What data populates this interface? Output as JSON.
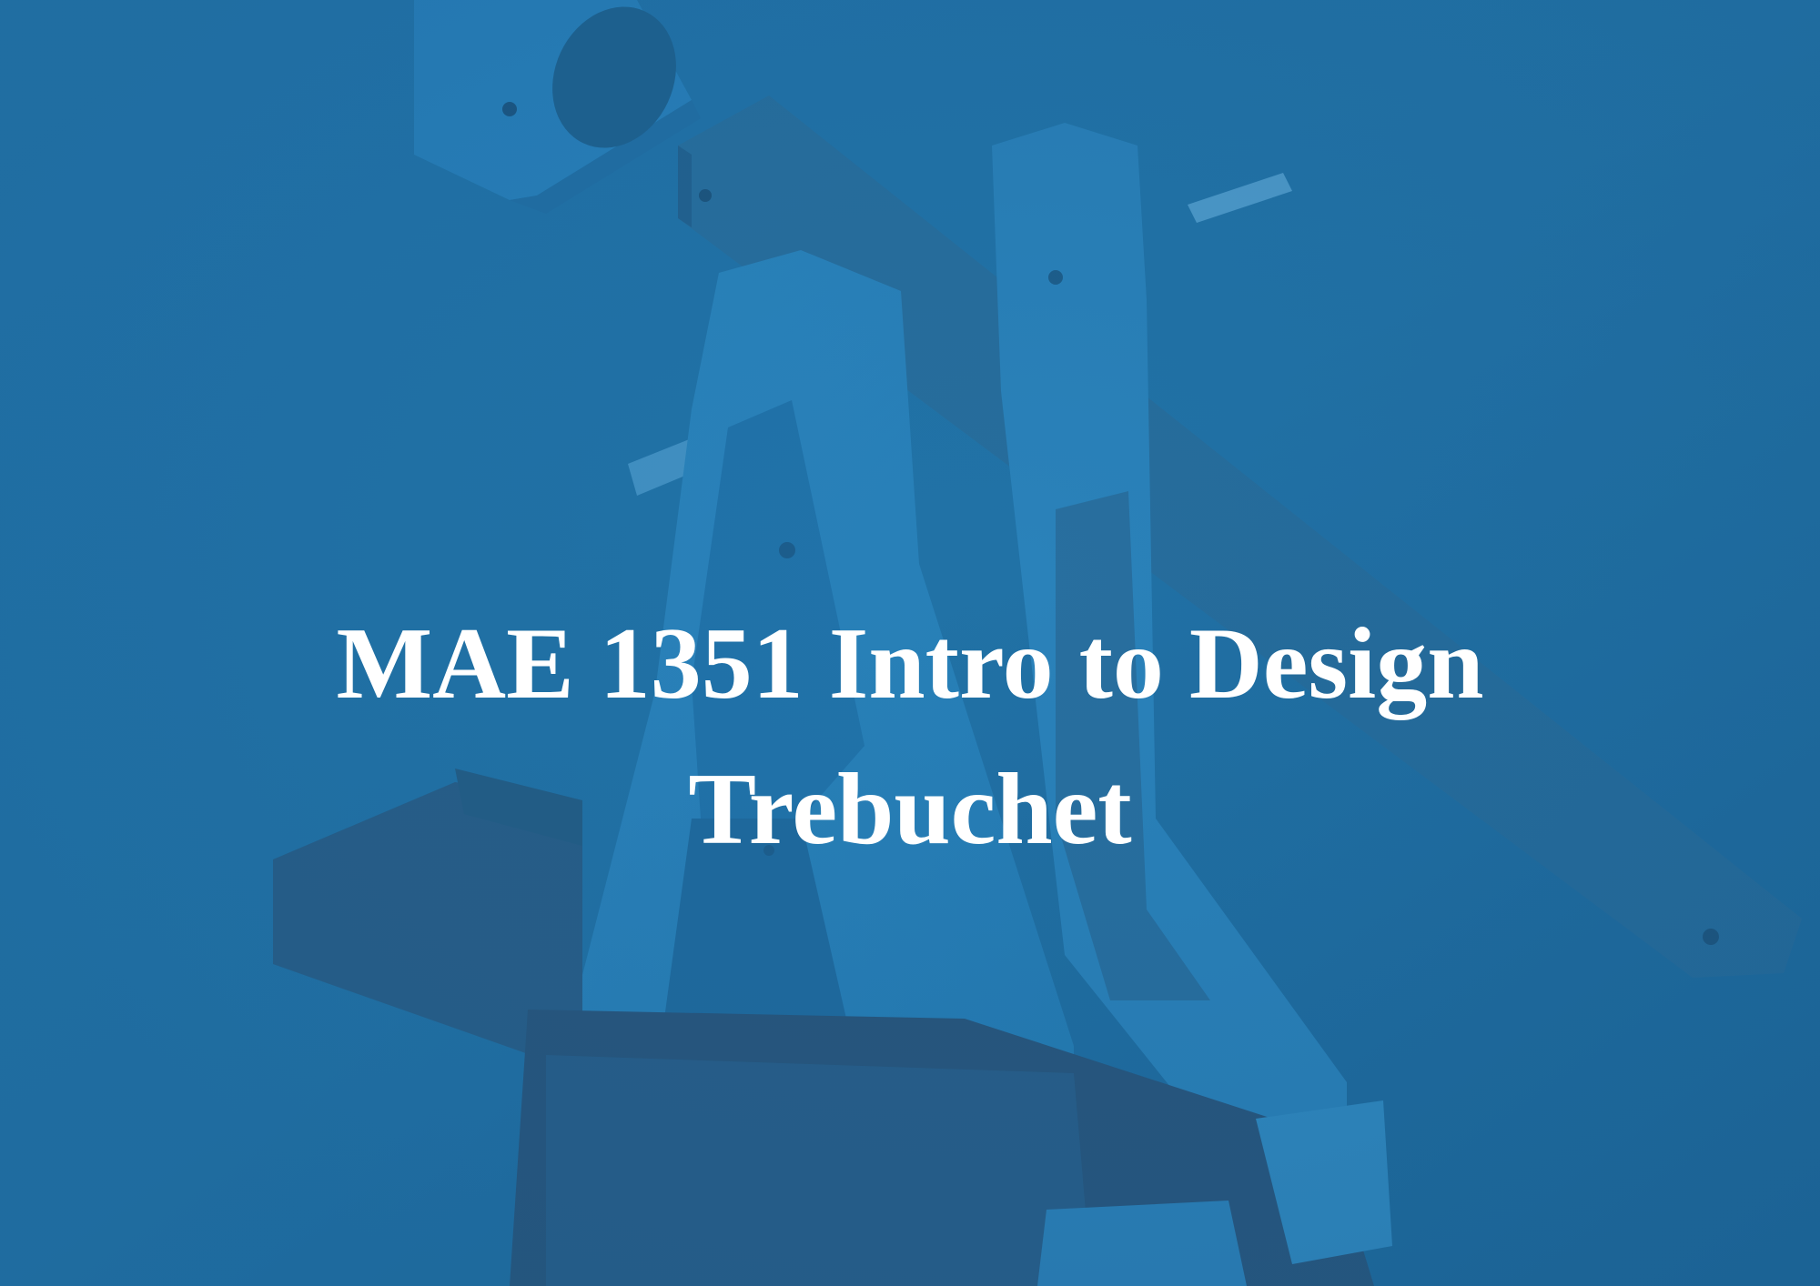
{
  "slide": {
    "title_line_1": "MAE 1351 Intro to Design",
    "title_line_2": "Trebuchet",
    "background_image": "trebuchet-photo-blue-tint",
    "tint_color": "#1f6fa3",
    "text_color": "#ffffff"
  }
}
